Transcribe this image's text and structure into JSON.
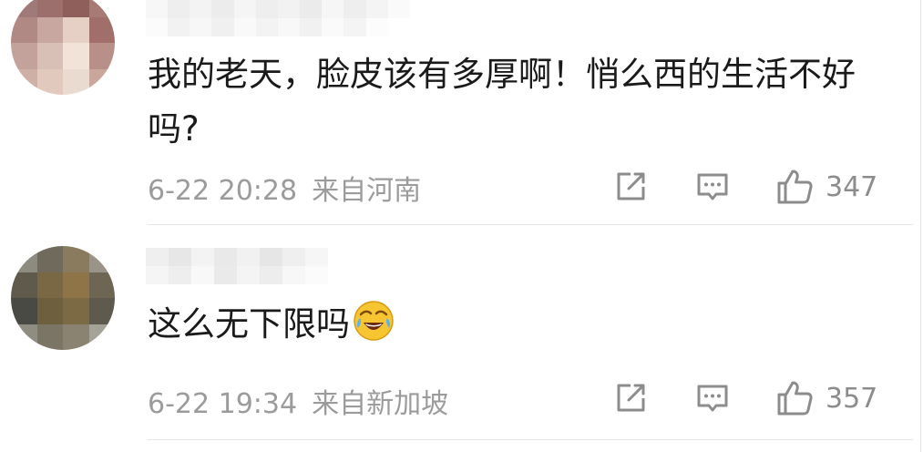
{
  "comments": [
    {
      "text": "我的老天，脸皮该有多厚啊！悄么西的生活不好吗?",
      "time": "6-22 20:28",
      "location": "来自河南",
      "like_count": "347",
      "avatar_icon": "blurred-avatar",
      "avatar_colors": [
        "#a07a78",
        "#9d6f6c",
        "#8f5f5c",
        "#a87a74",
        "#b08884",
        "#c8a7a0",
        "#e6cfc4",
        "#a06f69",
        "#c2a29b",
        "#d9c0b6",
        "#f2e3d9",
        "#b99089",
        "#cfb0a7",
        "#e2c9be",
        "#eadbd1",
        "#c9a79d"
      ]
    },
    {
      "text": "这么无下限吗",
      "emoji_icon": "laughing-crying-emoji",
      "time": "6-22 19:34",
      "location": "来自新加坡",
      "like_count": "357",
      "avatar_icon": "blurred-avatar",
      "avatar_colors": [
        "#8d8a80",
        "#6f6a5c",
        "#8a7b5e",
        "#9a9488",
        "#5f5a4c",
        "#7a6845",
        "#8e7446",
        "#6d6652",
        "#4a4a44",
        "#6e5f3e",
        "#7c6a44",
        "#5e5a4d",
        "#8f8c82",
        "#7b7565",
        "#8a8371",
        "#a5a297"
      ]
    }
  ],
  "icons": {
    "share": "share-icon",
    "reply": "comment-icon",
    "like": "thumbs-up-icon"
  },
  "colors": {
    "text": "#1a1a1a",
    "meta": "#9b9b9b",
    "icon": "#8c8c8c",
    "divider": "#e6e6e6"
  }
}
